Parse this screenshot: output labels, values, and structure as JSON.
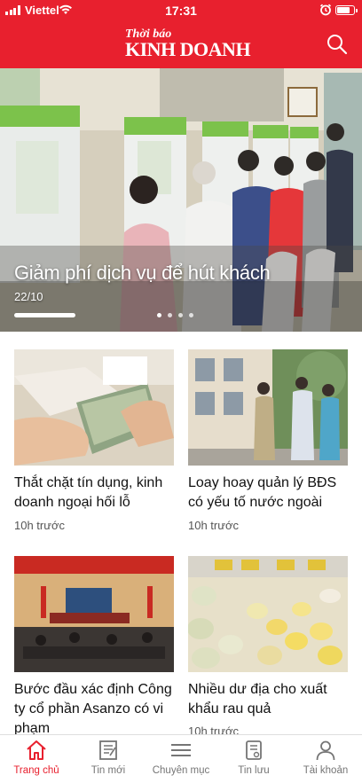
{
  "status_bar": {
    "carrier": "Viettel",
    "time": "17:31",
    "battery_level": 0.8
  },
  "header": {
    "logo_top": "Thời báo",
    "logo_main": "KINH DOANH",
    "search_icon": "search-icon",
    "brand_color": "#e8202e"
  },
  "hero": {
    "title": "Giảm phí dịch vụ để hút khách",
    "date": "22/10",
    "slide_count": 4,
    "active_slide": 1
  },
  "articles": [
    {
      "title": "Thắt chặt tín dụng, kinh doanh ngoại hối lỗ",
      "time": "10h trước"
    },
    {
      "title": "Loay hoay quản lý BĐS có yếu tố nước ngoài",
      "time": "10h trước"
    },
    {
      "title": "Bước đầu xác định Công ty cổ phần Asanzo có vi phạm",
      "time": ""
    },
    {
      "title": "Nhiều dư địa cho xuất khẩu rau quả",
      "time": "10h trước"
    }
  ],
  "tabbar": {
    "active_color": "#e8202e",
    "items": [
      {
        "label": "Trang chủ",
        "icon": "home-icon"
      },
      {
        "label": "Tin mới",
        "icon": "news-icon"
      },
      {
        "label": "Chuyên mục",
        "icon": "menu-icon"
      },
      {
        "label": "Tin lưu",
        "icon": "saved-icon"
      },
      {
        "label": "Tài khoản",
        "icon": "account-icon"
      }
    ]
  }
}
